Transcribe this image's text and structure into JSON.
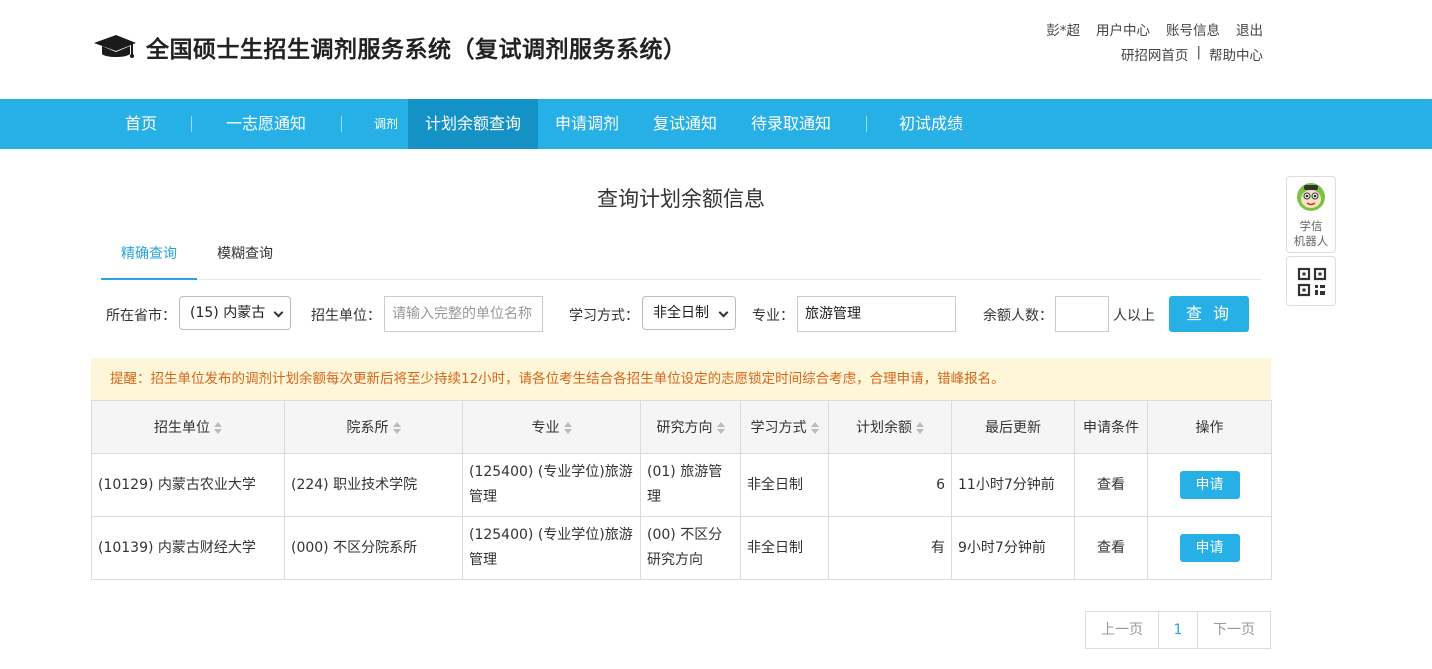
{
  "header": {
    "title": "全国硕士生招生调剂服务系统（复试调剂服务系统）",
    "user_links": [
      "彭*超",
      "用户中心",
      "账号信息",
      "退出"
    ],
    "help_links": {
      "home": "研招网首页",
      "sep": "|",
      "help": "帮助中心"
    }
  },
  "nav": {
    "items": [
      "首页",
      "一志愿通知",
      "计划余额查询",
      "申请调剂",
      "复试通知",
      "待录取通知",
      "初试成绩"
    ],
    "small_label": "调剂",
    "active": "计划余额查询"
  },
  "page": {
    "title": "查询计划余额信息",
    "tabs": [
      "精确查询",
      "模糊查询"
    ]
  },
  "filters": {
    "province_label": "所在省市：",
    "province_value": "(15) 内蒙古",
    "unit_label": "招生单位：",
    "unit_placeholder": "请输入完整的单位名称",
    "study_label": "学习方式：",
    "study_value": "非全日制",
    "major_label": "专业：",
    "major_value": "旅游管理",
    "remain_label": "余额人数：",
    "remain_value": "",
    "remain_suffix": "人以上",
    "query_button": "查 询"
  },
  "notice": "提醒：招生单位发布的调剂计划余额每次更新后将至少持续12小时，请各位考生结合各招生单位设定的志愿锁定时间综合考虑，合理申请，错峰报名。",
  "table": {
    "headers": [
      "招生单位",
      "院系所",
      "专业",
      "研究方向",
      "学习方式",
      "计划余额",
      "最后更新",
      "申请条件",
      "操作"
    ],
    "rows": [
      {
        "unit": "(10129) 内蒙古农业大学",
        "dept": "(224) 职业技术学院",
        "major": "(125400) (专业学位)旅游管理",
        "direction": "(01) 旅游管理",
        "mode": "非全日制",
        "remain": "6",
        "updated": "11小时7分钟前",
        "condition": "查看",
        "action": "申请"
      },
      {
        "unit": "(10139) 内蒙古财经大学",
        "dept": "(000) 不区分院系所",
        "major": "(125400) (专业学位)旅游管理",
        "direction": "(00) 不区分研究方向",
        "mode": "非全日制",
        "remain": "有",
        "updated": "9小时7分钟前",
        "condition": "查看",
        "action": "申请"
      }
    ]
  },
  "pagination": {
    "prev": "上一页",
    "current": "1",
    "next": "下一页"
  },
  "side": {
    "robot_label_1": "学信",
    "robot_label_2": "机器人"
  },
  "colors": {
    "nav": "#27b0e6",
    "nav_active": "#1592c5",
    "link": "#27a5dc",
    "notice_bg": "#fdf6d9",
    "notice_text": "#d5671a"
  }
}
